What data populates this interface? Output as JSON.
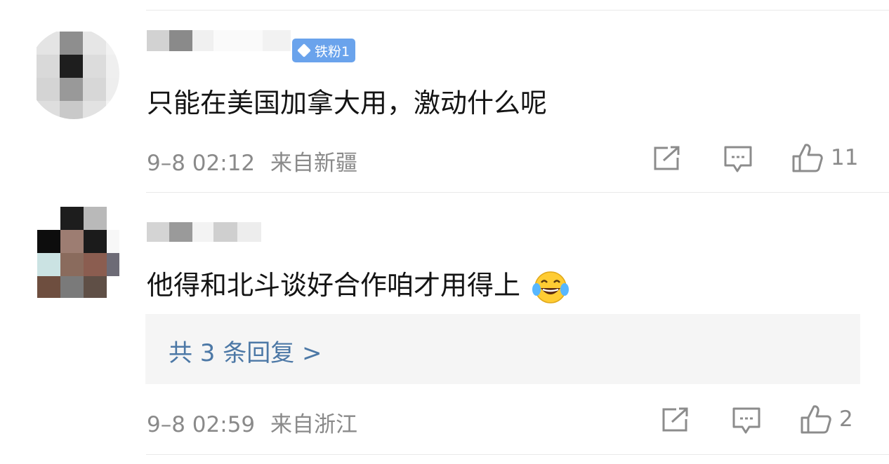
{
  "comments": [
    {
      "badge": "铁粉1",
      "text": "只能在美国加拿大用，激动什么呢",
      "time": "9–8 02:12",
      "location": "来自新疆",
      "like_count": "11"
    },
    {
      "text": "他得和北斗谈好合作咱才用得上",
      "emoji": "laughing-tears-emoji",
      "reply_summary": "共 3 条回复 >",
      "time": "9–8 02:59",
      "location": "来自浙江",
      "like_count": "2"
    }
  ],
  "icons": {
    "share": "share-icon",
    "comment": "comment-icon",
    "like": "thumbs-up-icon"
  },
  "colors": {
    "link": "#4c78a6",
    "badge": "#6aa3ec",
    "meta": "#8a8a8a"
  }
}
